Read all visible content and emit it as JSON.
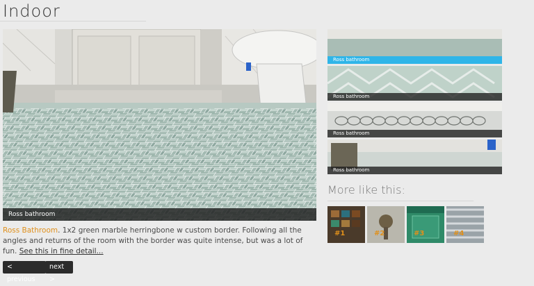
{
  "page": {
    "title": "Indoor"
  },
  "main_image": {
    "caption": "Ross bathroom"
  },
  "description": {
    "accent": "Ross Bathroom",
    "text": ". 1x2 green marble herringbone w custom border. Following all the angles and returns of the room with the border was quite intense, but was a lot of fun. ",
    "link": "See this in fine detail..."
  },
  "navigation": {
    "prev_label": "< previous",
    "next_label": "next >"
  },
  "thumbnails": [
    {
      "caption": "Ross bathroom",
      "active": true
    },
    {
      "caption": "Ross bathroom",
      "active": false
    },
    {
      "caption": "Ross bathroom",
      "active": false
    },
    {
      "caption": "Ross bathroom",
      "active": false
    }
  ],
  "more_like_this": {
    "title": "More like this:",
    "items": [
      {
        "label": "#1"
      },
      {
        "label": "#2"
      },
      {
        "label": "#3"
      },
      {
        "label": "#4"
      }
    ]
  },
  "colors": {
    "accent": "#e0901b",
    "active_caption": "#2fb5e8"
  }
}
